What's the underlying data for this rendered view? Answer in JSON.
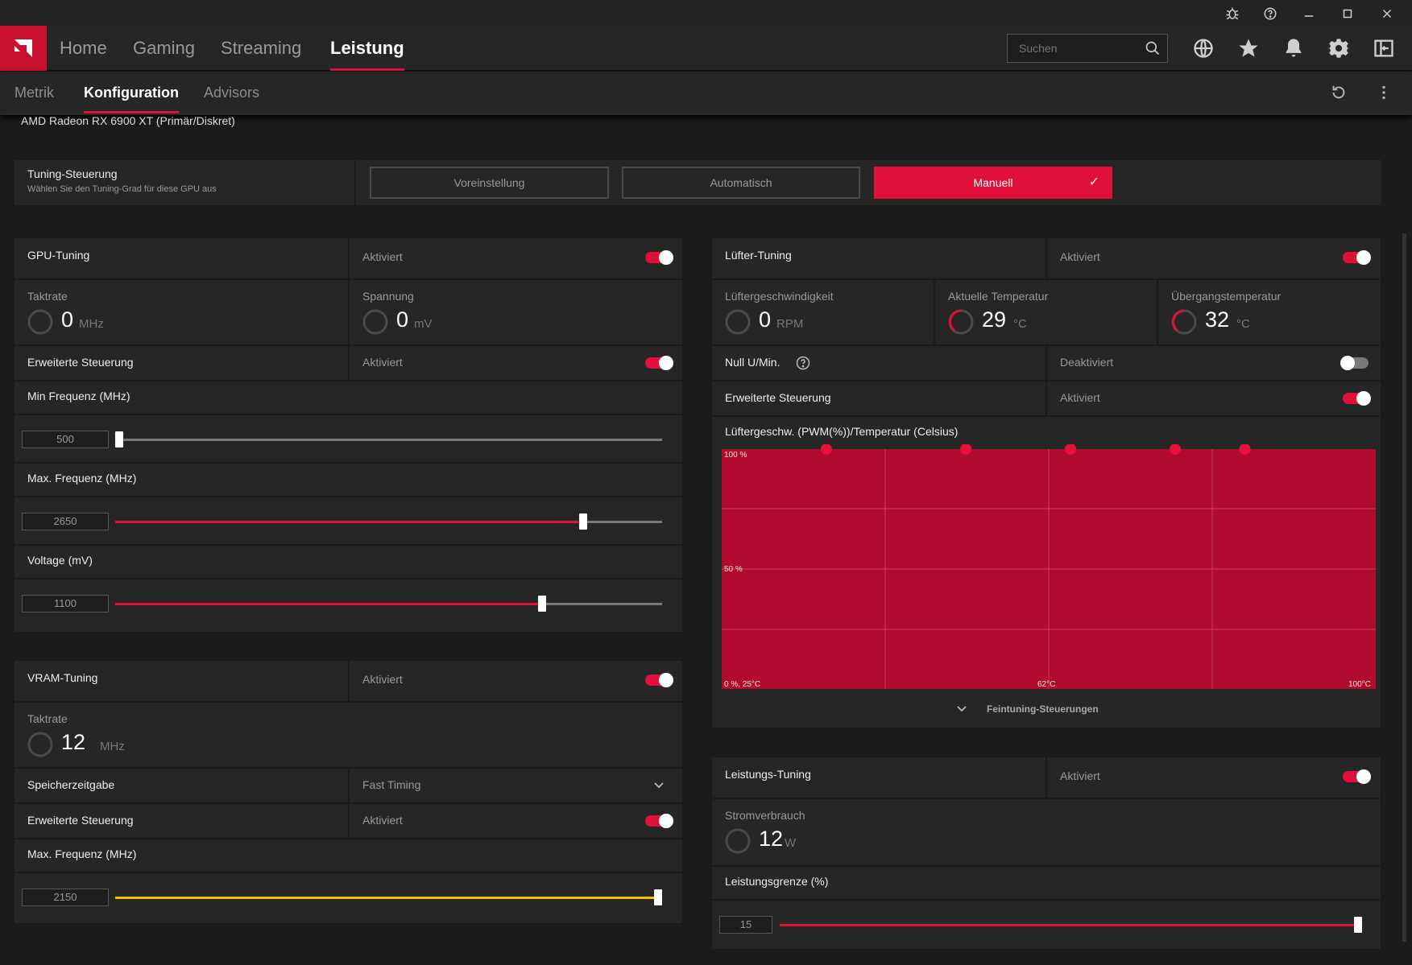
{
  "window": {
    "icons": [
      "bug-icon",
      "help-icon",
      "minimize-icon",
      "maximize-icon",
      "close-icon"
    ]
  },
  "nav": {
    "items": [
      {
        "label": "Home"
      },
      {
        "label": "Gaming"
      },
      {
        "label": "Streaming"
      },
      {
        "label": "Leistung"
      }
    ],
    "active": "Leistung",
    "search_placeholder": "Suchen"
  },
  "subnav": {
    "items": [
      {
        "label": "Metrik"
      },
      {
        "label": "Konfiguration"
      },
      {
        "label": "Advisors"
      }
    ],
    "active": "Konfiguration"
  },
  "gpu_name": "AMD Radeon RX 6900 XT (Primär/Diskret)",
  "tuning_control": {
    "title": "Tuning-Steuerung",
    "subtitle": "Wählen Sie den Tuning-Grad für diese GPU aus",
    "options": [
      "Voreinstellung",
      "Automatisch",
      "Manuell"
    ],
    "selected": "Manuell"
  },
  "gpu_tuning": {
    "title": "GPU-Tuning",
    "status": "Aktiviert",
    "enabled": true,
    "clock": {
      "label": "Taktrate",
      "value": "0",
      "unit": "MHz"
    },
    "voltage": {
      "label": "Spannung",
      "value": "0",
      "unit": "mV"
    },
    "advanced": {
      "label": "Erweiterte Steuerung",
      "status": "Aktiviert",
      "enabled": true
    },
    "min_freq": {
      "label": "Min Frequenz (MHz)",
      "value": "500",
      "fraction": 0.0
    },
    "max_freq": {
      "label": "Max. Frequenz (MHz)",
      "value": "2650",
      "fraction": 0.855
    },
    "voltage_slider": {
      "label": "Voltage (mV)",
      "value": "1100",
      "fraction": 0.78
    }
  },
  "vram_tuning": {
    "title": "VRAM-Tuning",
    "status": "Aktiviert",
    "enabled": true,
    "clock": {
      "label": "Taktrate",
      "value": "12",
      "unit": "MHz"
    },
    "timing": {
      "label": "Speicherzeitgabe",
      "value": "Fast Timing"
    },
    "advanced": {
      "label": "Erweiterte Steuerung",
      "status": "Aktiviert",
      "enabled": true
    },
    "max_freq": {
      "label": "Max. Frequenz (MHz)",
      "value": "2150",
      "fraction": 1.0
    }
  },
  "fan_tuning": {
    "title": "Lüfter-Tuning",
    "status": "Aktiviert",
    "enabled": true,
    "fan_speed": {
      "label": "Lüftergeschwindigkeit",
      "value": "0",
      "unit": "RPM"
    },
    "current_temp": {
      "label": "Aktuelle Temperatur",
      "value": "29",
      "unit": "°C"
    },
    "junction_temp": {
      "label": "Übergangstemperatur",
      "value": "32",
      "unit": "°C"
    },
    "zero_rpm": {
      "label": "Null U/Min.",
      "status": "Deaktiviert",
      "enabled": false
    },
    "advanced": {
      "label": "Erweiterte Steuerung",
      "status": "Aktiviert",
      "enabled": true
    },
    "curve_label": "Lüftergeschw. (PWM(%))/Temperatur (Celsius)",
    "chart": {
      "y_top": "100 %",
      "y_mid": "50 %",
      "x_min": "0 %, 25°C",
      "x_mid": "62°C",
      "x_max": "100°C",
      "color": "#b00a2e",
      "points": [
        {
          "temp": 37,
          "pwm": 100
        },
        {
          "temp": 53,
          "pwm": 100
        },
        {
          "temp": 65,
          "pwm": 100
        },
        {
          "temp": 77,
          "pwm": 100
        },
        {
          "temp": 85,
          "pwm": 100
        }
      ]
    },
    "fine_tuning": "Feintuning-Steuerungen"
  },
  "power_tuning": {
    "title": "Leistungs-Tuning",
    "status": "Aktiviert",
    "enabled": true,
    "power": {
      "label": "Stromverbrauch",
      "value": "12",
      "unit": "W"
    },
    "limit": {
      "label": "Leistungsgrenze (%)",
      "value": "15",
      "fraction": 1.0
    }
  },
  "colors": {
    "accent": "#e0103a",
    "panel": "#262626",
    "bg": "#1b1b1b",
    "vram_slider": "#f2c200"
  }
}
